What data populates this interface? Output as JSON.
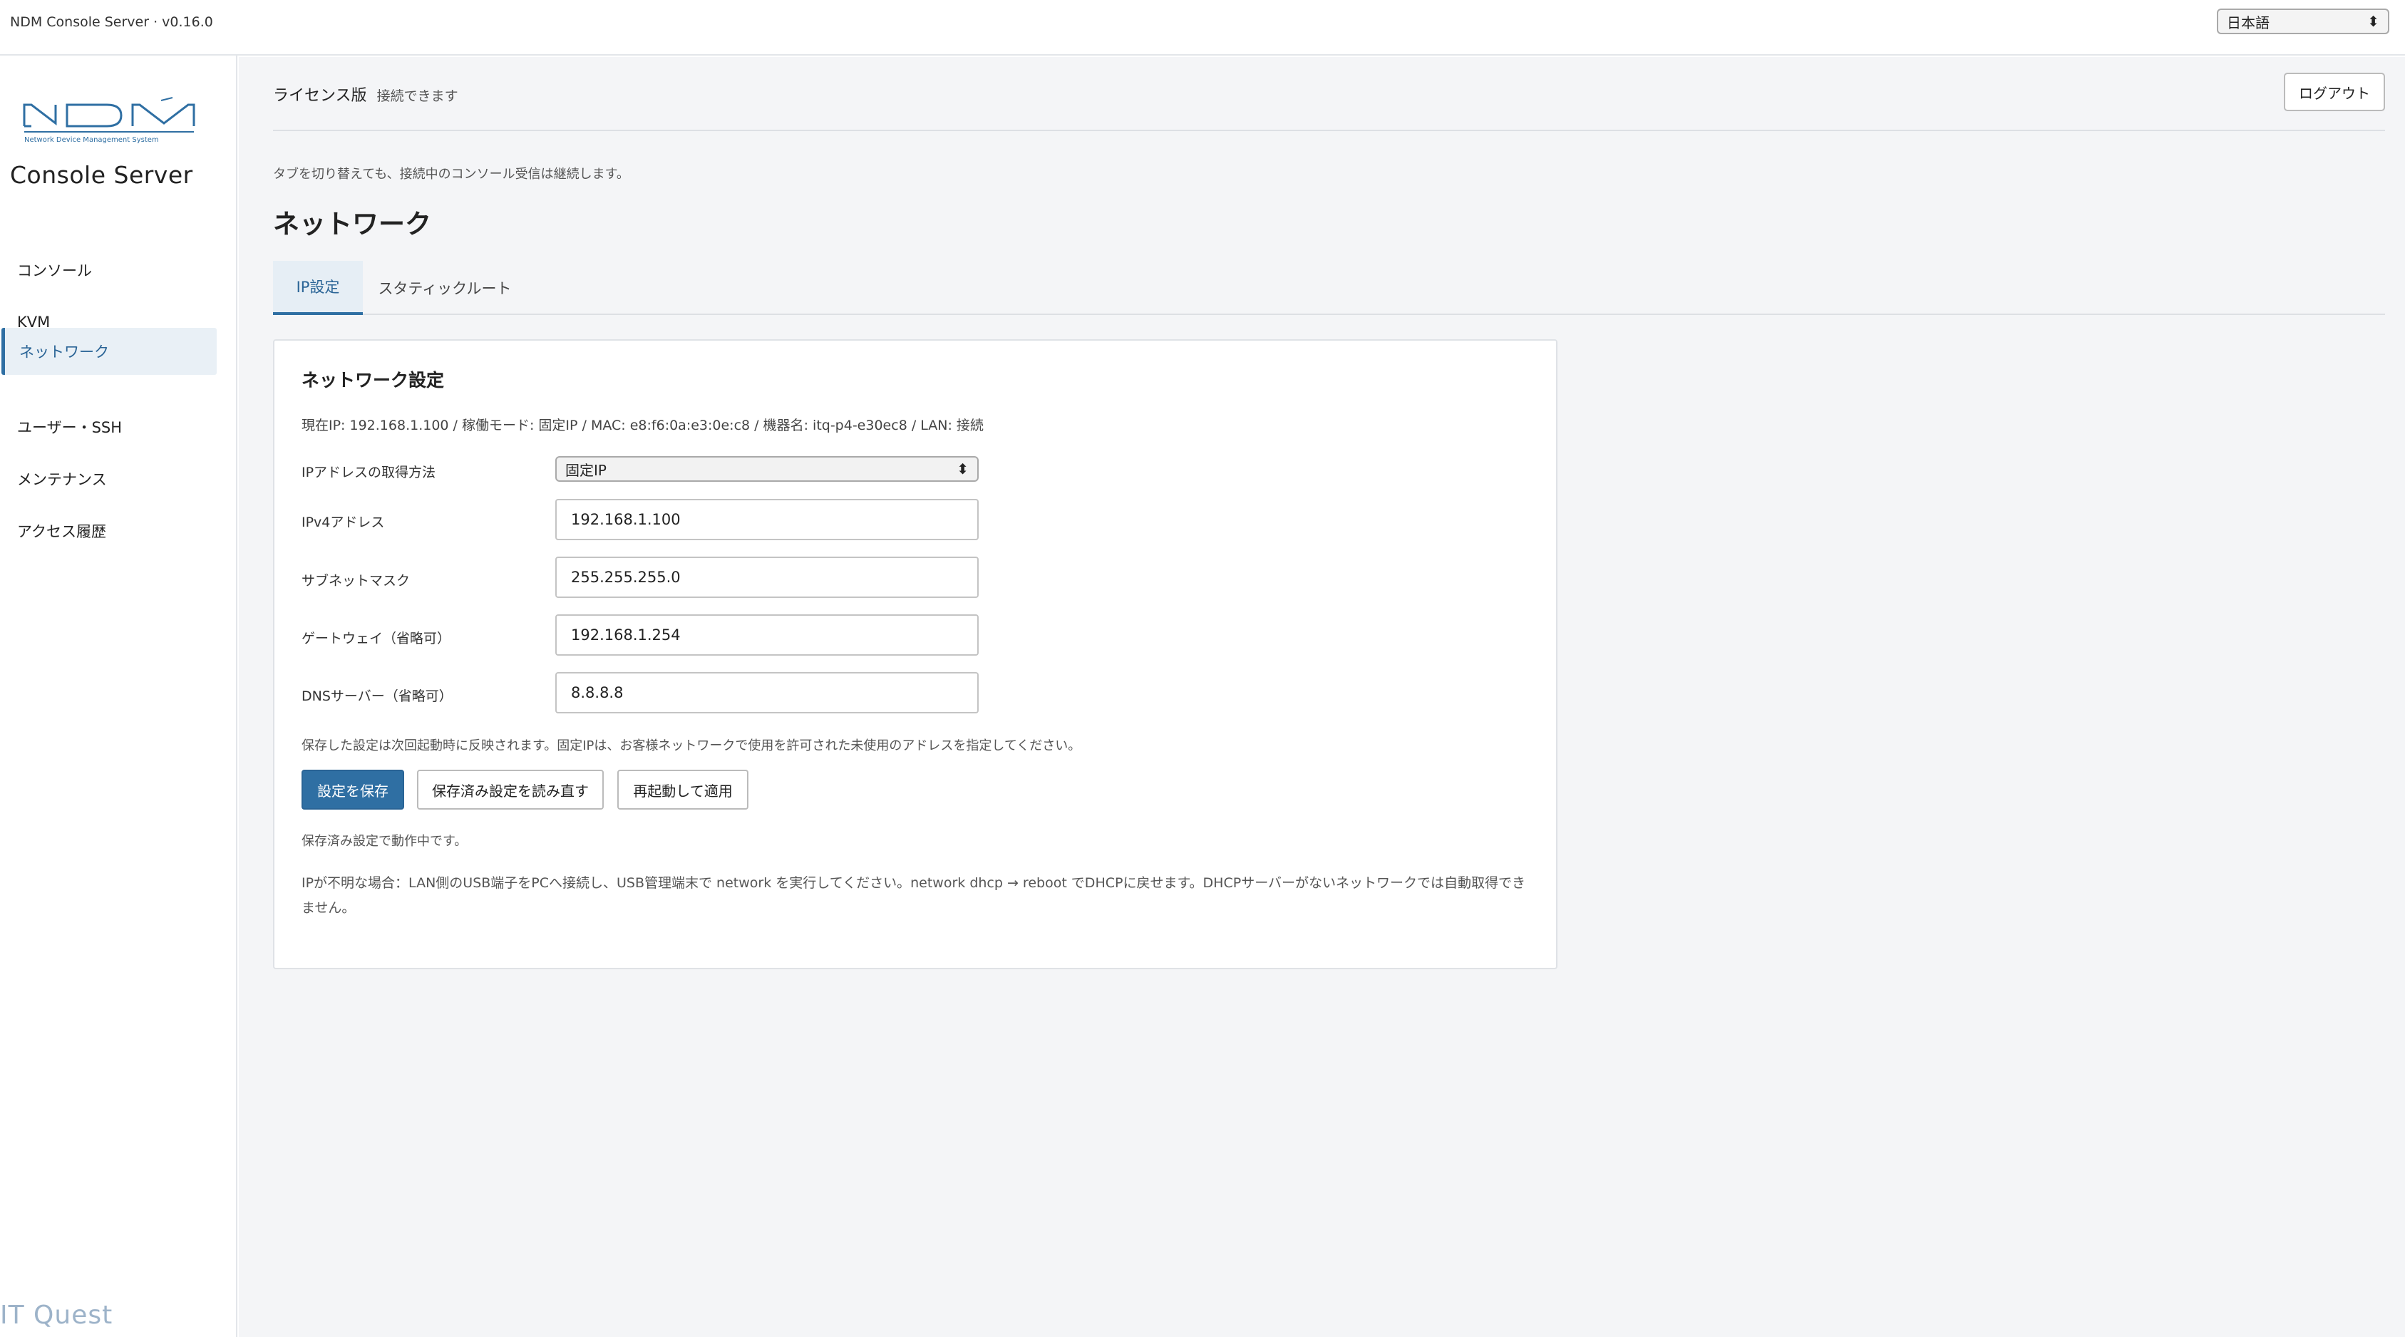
{
  "topbar": {
    "app_title": "NDM Console Server · v0.16.0",
    "language": {
      "selected": "日本語"
    }
  },
  "sidebar": {
    "logo_text": "NDM",
    "logo_subtitle": "Network Device Management System",
    "brand": "Console Server",
    "items": [
      {
        "label": "コンソール"
      },
      {
        "label": "KVM"
      },
      {
        "label": "ネットワーク",
        "active": true
      },
      {
        "label": "ユーザー・SSH"
      },
      {
        "label": "メンテナンス"
      },
      {
        "label": "アクセス履歴"
      }
    ],
    "watermark": "IT Quest"
  },
  "header": {
    "license_label": "ライセンス版",
    "license_status": "接続できます",
    "logout_label": "ログアウト"
  },
  "main": {
    "hint": "タブを切り替えても、接続中のコンソール受信は継続します。",
    "page_title": "ネットワーク",
    "tabs": [
      {
        "label": "IP設定",
        "active": true
      },
      {
        "label": "スタティックルート"
      }
    ]
  },
  "card": {
    "title": "ネットワーク設定",
    "status_line": "現在IP: 192.168.1.100 / 稼働モード: 固定IP / MAC: e8:f6:0a:e3:0e:c8 / 機器名: itq-p4-e30ec8 / LAN: 接続",
    "fields": {
      "method_label": "IPアドレスの取得方法",
      "method_value": "固定IP",
      "ipv4_label": "IPv4アドレス",
      "ipv4_value": "192.168.1.100",
      "subnet_label": "サブネットマスク",
      "subnet_value": "255.255.255.0",
      "gateway_label": "ゲートウェイ（省略可）",
      "gateway_value": "192.168.1.254",
      "dns_label": "DNSサーバー（省略可）",
      "dns_value": "8.8.8.8"
    },
    "save_note": "保存した設定は次回起動時に反映されます。固定IPは、お客様ネットワークで使用を許可された未使用のアドレスを指定してください。",
    "buttons": {
      "save": "設定を保存",
      "reload": "保存済み設定を読み直す",
      "reboot": "再起動して適用"
    },
    "running_status": "保存済み設定で動作中です。",
    "help_text": "IPが不明な場合：LAN側のUSB端子をPCへ接続し、USB管理端末で network を実行してください。network dhcp → reboot でDHCPに戻せます。DHCPサーバーがないネットワークでは自動取得できません。"
  },
  "colors": {
    "accent": "#2f6fa3",
    "active_bg": "#e9f0f6",
    "main_bg": "#f4f5f7"
  }
}
